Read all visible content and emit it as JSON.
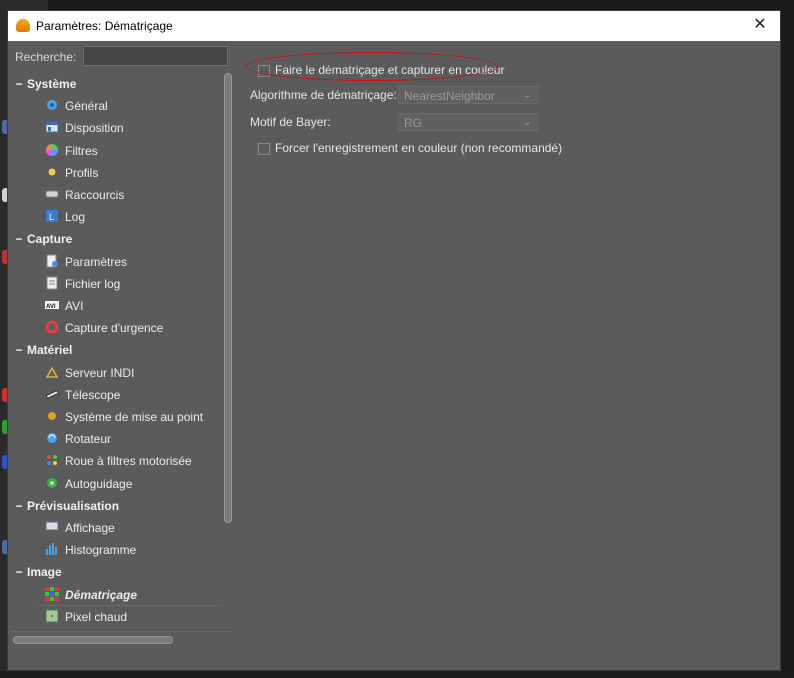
{
  "window": {
    "title": "Paramètres: Dématriçage",
    "close_label": "✕"
  },
  "search": {
    "label": "Recherche:",
    "value": ""
  },
  "tree": [
    {
      "kind": "cat",
      "label": "Système",
      "expander": "−"
    },
    {
      "kind": "item",
      "label": "Général",
      "icon": "gear-icon"
    },
    {
      "kind": "item",
      "label": "Disposition",
      "icon": "layout-icon"
    },
    {
      "kind": "item",
      "label": "Filtres",
      "icon": "color-wheel-icon"
    },
    {
      "kind": "item",
      "label": "Profils",
      "icon": "star-icon"
    },
    {
      "kind": "item",
      "label": "Raccourcis",
      "icon": "keyboard-icon"
    },
    {
      "kind": "item",
      "label": "Log",
      "icon": "log-icon"
    },
    {
      "kind": "cat",
      "label": "Capture",
      "expander": "−"
    },
    {
      "kind": "item",
      "label": "Paramètres",
      "icon": "settings-doc-icon"
    },
    {
      "kind": "item",
      "label": "Fichier log",
      "icon": "file-icon"
    },
    {
      "kind": "item",
      "label": "AVI",
      "icon": "avi-icon"
    },
    {
      "kind": "item",
      "label": "Capture d'urgence",
      "icon": "lifebuoy-icon"
    },
    {
      "kind": "cat",
      "label": "Matériel",
      "expander": "−"
    },
    {
      "kind": "item",
      "label": "Serveur INDI",
      "icon": "indi-server-icon"
    },
    {
      "kind": "item",
      "label": "Télescope",
      "icon": "telescope-icon"
    },
    {
      "kind": "item",
      "label": "Système de mise au point",
      "icon": "focuser-icon"
    },
    {
      "kind": "item",
      "label": "Rotateur",
      "icon": "rotator-icon"
    },
    {
      "kind": "item",
      "label": "Roue à filtres motorisée",
      "icon": "filter-wheel-icon"
    },
    {
      "kind": "item",
      "label": "Autoguidage",
      "icon": "autoguide-icon"
    },
    {
      "kind": "cat",
      "label": "Prévisualisation",
      "expander": "−"
    },
    {
      "kind": "item",
      "label": "Affichage",
      "icon": "monitor-icon"
    },
    {
      "kind": "item",
      "label": "Histogramme",
      "icon": "histogram-icon"
    },
    {
      "kind": "cat",
      "label": "Image",
      "expander": "−"
    },
    {
      "kind": "item",
      "label": "Dématriçage",
      "icon": "bayer-grid-icon",
      "selected": true
    },
    {
      "kind": "item",
      "label": "Pixel chaud",
      "icon": "hot-pixel-icon"
    }
  ],
  "form": {
    "debayer_checkbox": {
      "label": "Faire le dématriçage et capturer en couleur",
      "checked": false
    },
    "algorithm": {
      "label": "Algorithme de dématriçage:",
      "value": "NearestNeighbor"
    },
    "bayer_pattern": {
      "label": "Motif de Bayer:",
      "value": "RG"
    },
    "force_color_checkbox": {
      "label": "Forcer l'enregistrement en couleur (non recommandé)",
      "checked": false
    }
  },
  "colors": {
    "accent_annotation": "#cc1010",
    "panel": "#5b5b5b"
  }
}
